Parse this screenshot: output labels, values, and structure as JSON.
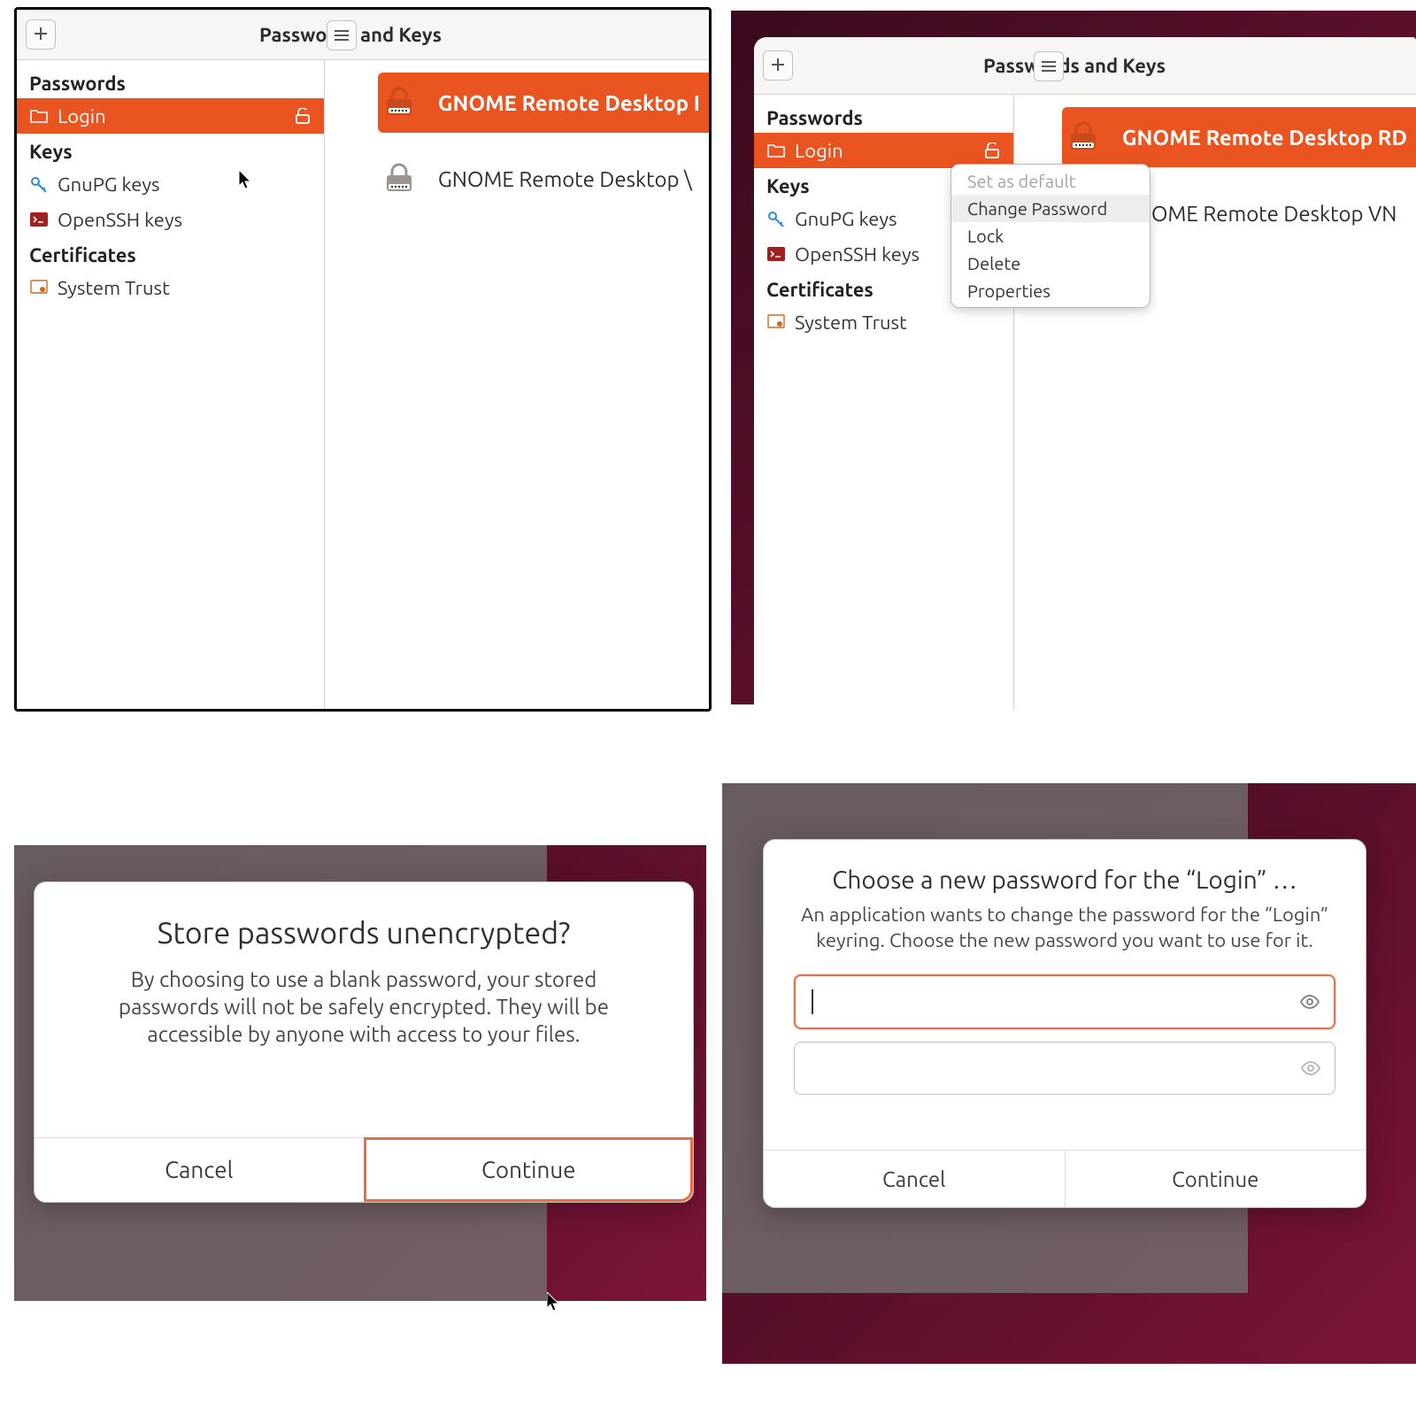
{
  "app": {
    "title": "Passwords and Keys"
  },
  "sidebar": {
    "headings": {
      "passwords": "Passwords",
      "keys": "Keys",
      "certs": "Certificates"
    },
    "items": {
      "login": "Login",
      "gnupg": "GnuPG keys",
      "openssh": "OpenSSH keys",
      "systrust": "System Trust"
    }
  },
  "content": {
    "rows": {
      "rdp_full": "GNOME Remote Desktop RDP",
      "vnc_full": "GNOME Remote Desktop VNC",
      "rdp_clip1": "GNOME Remote Desktop I",
      "vnc_clip1": "GNOME Remote Desktop \\",
      "rdp_clip2": "GNOME Remote Desktop RD",
      "vnc_clip2": "GNOME Remote Desktop VN"
    }
  },
  "context_menu": {
    "set_default": "Set as default",
    "change_pwd": "Change Password",
    "lock": "Lock",
    "delete": "Delete",
    "properties": "Properties"
  },
  "dialog_unencrypted": {
    "title": "Store passwords unencrypted?",
    "body": "By choosing to use a blank password, your stored passwords will not be safely encrypted. They will be accessible by anyone with access to your files.",
    "cancel": "Cancel",
    "continue": "Continue"
  },
  "dialog_newpwd": {
    "title": "Choose a new password for the “Login” …",
    "body": "An application wants to change the password for the “Login” keyring. Choose the new password you want to use for it.",
    "cancel": "Cancel",
    "continue": "Continue"
  },
  "colors": {
    "orange": "#e95420",
    "wine": "#5a0f2b"
  }
}
